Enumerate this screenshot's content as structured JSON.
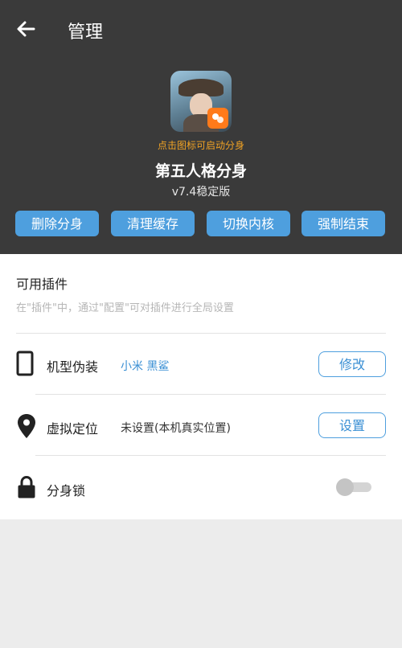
{
  "header": {
    "title": "管理",
    "back_icon": "arrow-left-icon"
  },
  "app": {
    "hint": "点击图标可启动分身",
    "name": "第五人格分身",
    "version": "v7.4稳定版"
  },
  "actions": [
    {
      "label": "删除分身"
    },
    {
      "label": "清理缓存"
    },
    {
      "label": "切换内核"
    },
    {
      "label": "强制结束"
    }
  ],
  "plugins": {
    "title": "可用插件",
    "description": "在\"插件\"中，通过\"配置\"可对插件进行全局设置"
  },
  "settings": {
    "device": {
      "label": "机型伪装",
      "value": "小米 黑鲨",
      "button": "修改",
      "icon": "phone-icon"
    },
    "location": {
      "label": "虚拟定位",
      "value": "未设置(本机真实位置)",
      "button": "设置",
      "icon": "location-pin-icon"
    },
    "lock": {
      "label": "分身锁",
      "icon": "lock-icon",
      "enabled": false
    }
  },
  "colors": {
    "header_bg": "#3a3a3a",
    "accent": "#4e9fde",
    "hint": "#f0a224"
  }
}
